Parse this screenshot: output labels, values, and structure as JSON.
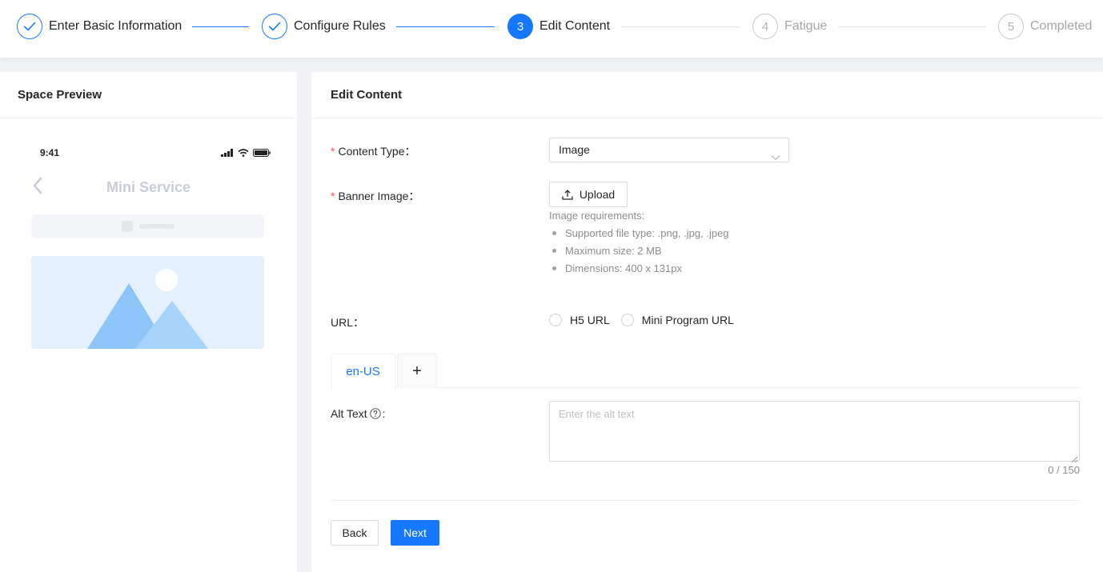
{
  "steps": [
    {
      "title": "Enter Basic Information",
      "status": "done",
      "number": "1"
    },
    {
      "title": "Configure Rules",
      "status": "done",
      "number": "2"
    },
    {
      "title": "Edit Content",
      "status": "active",
      "number": "3"
    },
    {
      "title": "Fatigue",
      "status": "wait",
      "number": "4"
    },
    {
      "title": "Completed",
      "status": "wait",
      "number": "5"
    }
  ],
  "preview": {
    "title": "Space Preview",
    "phone_time": "9:41",
    "page_title": "Mini Service"
  },
  "edit": {
    "title": "Edit Content",
    "content_type_label": "Content Type",
    "content_type_value": "Image",
    "banner_label": "Banner Image",
    "upload_label": "Upload",
    "requirements_title": "Image requirements:",
    "requirements": [
      "Supported file type: .png, .jpg, .jpeg",
      "Maximum size: 2 MB",
      "Dimensions: 400 x 131px"
    ],
    "url_label": "URL",
    "url_options": [
      "H5 URL",
      "Mini Program URL"
    ],
    "tabs": [
      "en-US"
    ],
    "tab_add": "+",
    "alt_label": "Alt Text",
    "alt_placeholder": "Enter the alt text",
    "alt_counter": "0 / 150",
    "colon": "：",
    "colon_ascii": ":",
    "required_mark": "*"
  },
  "actions": {
    "back": "Back",
    "next": "Next"
  },
  "colors": {
    "primary": "#1677ff",
    "required": "#ff4d4f"
  }
}
